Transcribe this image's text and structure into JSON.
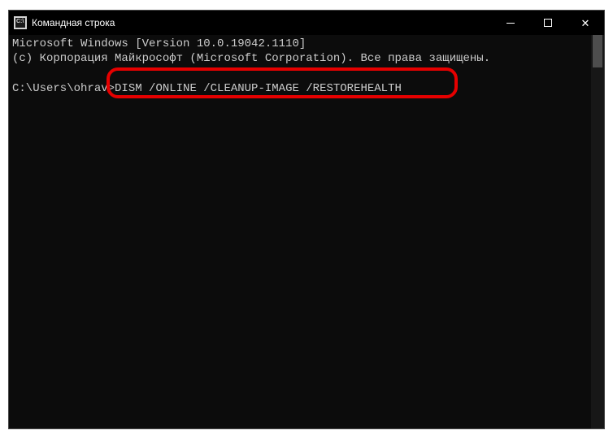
{
  "window": {
    "title": "Командная строка",
    "icon_label": "CMD"
  },
  "terminal": {
    "line1": "Microsoft Windows [Version 10.0.19042.1110]",
    "line2": "(c) Корпорация Майкрософт (Microsoft Corporation). Все права защищены.",
    "blank": "",
    "prompt": "C:\\Users\\ohrav>",
    "command": "DISM /ONLINE /CLEANUP-IMAGE /RESTOREHEALTH"
  }
}
